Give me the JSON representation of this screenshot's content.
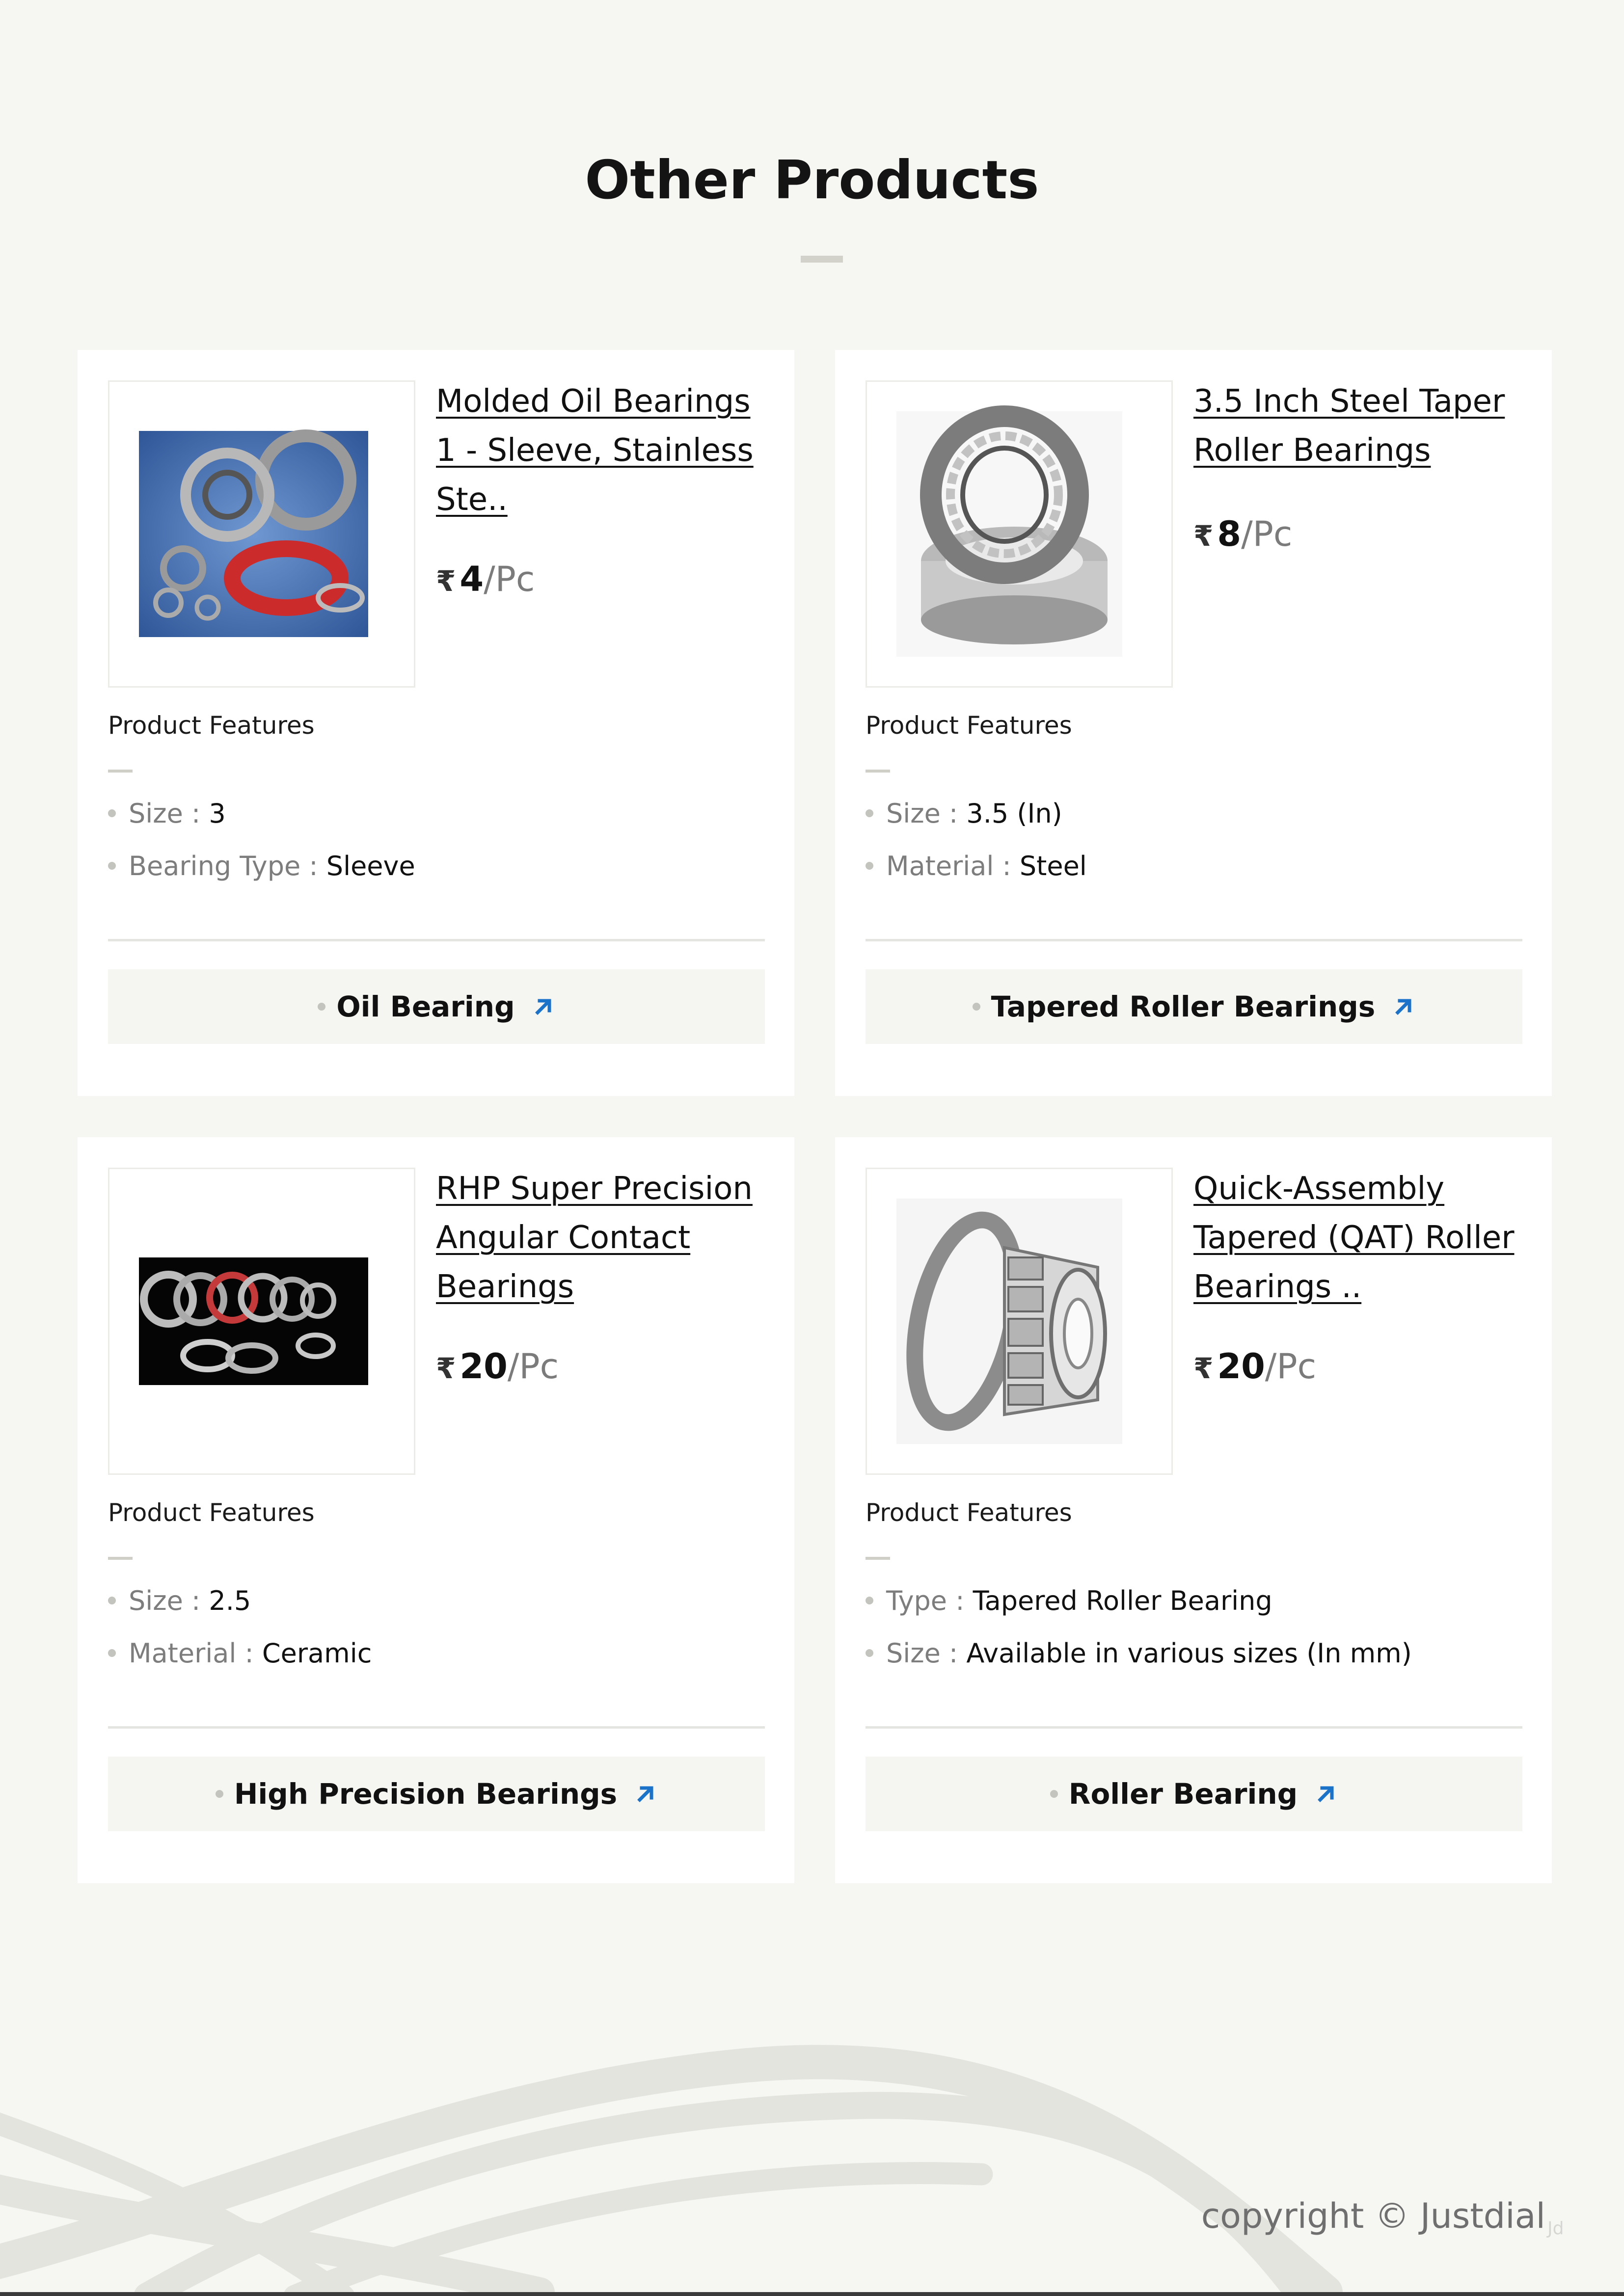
{
  "section": {
    "title": "Other Products"
  },
  "labels": {
    "product_features": "Product Features"
  },
  "products": [
    {
      "name": "Molded Oil Bearings 1 - Sleeve, Stainless Ste..",
      "currency": "₹",
      "price": "4",
      "unit": "/Pc",
      "features": [
        {
          "key": "Size :",
          "value": "3"
        },
        {
          "key": "Bearing Type :",
          "value": "Sleeve"
        }
      ],
      "category": "Oil Bearing",
      "image_icon": "ball-bearings-blue-icon"
    },
    {
      "name": "3.5 Inch Steel Taper Roller Bearings",
      "currency": "₹",
      "price": "8",
      "unit": "/Pc",
      "features": [
        {
          "key": "Size :",
          "value": "3.5 (In)"
        },
        {
          "key": "Material :",
          "value": "Steel"
        }
      ],
      "category": "Tapered Roller Bearings",
      "image_icon": "taper-roller-bearing-icon"
    },
    {
      "name": "RHP Super Precision Angular Contact Bearings",
      "currency": "₹",
      "price": "20",
      "unit": "/Pc",
      "features": [
        {
          "key": "Size :",
          "value": "2.5"
        },
        {
          "key": "Material :",
          "value": "Ceramic"
        }
      ],
      "category": "High Precision Bearings",
      "image_icon": "precision-bearings-black-icon"
    },
    {
      "name": "Quick-Assembly Tapered (QAT) Roller Bearings ..",
      "currency": "₹",
      "price": "20",
      "unit": "/Pc",
      "features": [
        {
          "key": "Type :",
          "value": "Tapered Roller Bearing"
        },
        {
          "key": "Size :",
          "value": "Available in various sizes (In mm)"
        }
      ],
      "category": "Roller Bearing",
      "image_icon": "tapered-roller-cone-icon"
    }
  ],
  "footer": {
    "copyright": "copyright © Justdial",
    "mark": "Jd"
  },
  "colors": {
    "accent": "#1a73c9",
    "background": "#f6f6f3",
    "card": "#ffffff"
  }
}
